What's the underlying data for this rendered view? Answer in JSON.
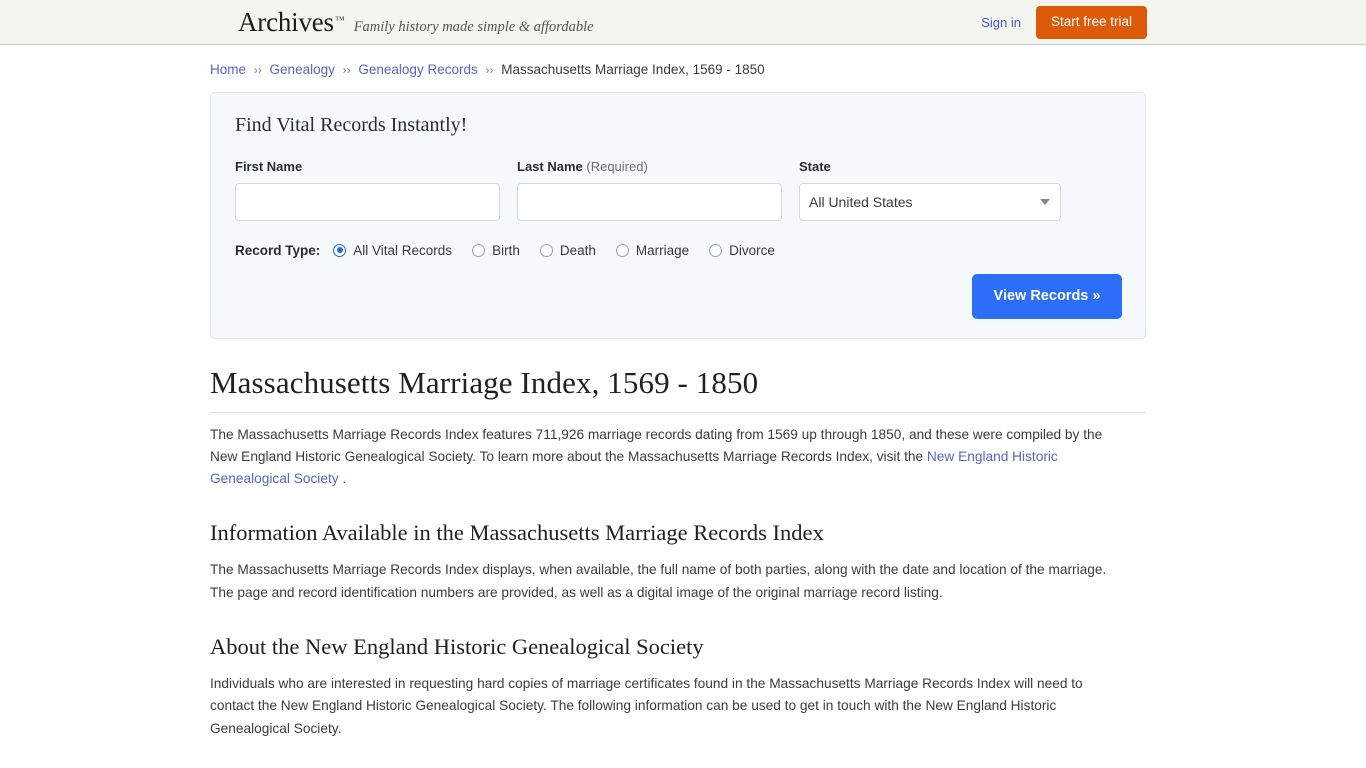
{
  "header": {
    "brand_name": "Archives",
    "brand_tm": "™",
    "tagline": "Family history made simple & affordable",
    "sign_in": "Sign in",
    "start_trial": "Start free trial",
    "trial_color": "#dd5a0b",
    "link_color": "#4257d6"
  },
  "breadcrumb": {
    "separator": "››",
    "items": [
      {
        "label": "Home",
        "is_link": true
      },
      {
        "label": "Genealogy",
        "is_link": true
      },
      {
        "label": "Genealogy Records",
        "is_link": true
      },
      {
        "label": "Massachusetts Marriage Index, 1569 - 1850",
        "is_link": false
      }
    ]
  },
  "search_form": {
    "title": "Find Vital Records Instantly!",
    "first_name": {
      "label": "First Name",
      "value": "",
      "placeholder": ""
    },
    "last_name": {
      "label": "Last Name",
      "required_note": "(Required)",
      "value": "",
      "placeholder": ""
    },
    "state": {
      "label": "State",
      "selected": "All United States"
    },
    "record_type": {
      "label": "Record Type:",
      "options": [
        {
          "label": "All Vital Records",
          "checked": true
        },
        {
          "label": "Birth",
          "checked": false
        },
        {
          "label": "Death",
          "checked": false
        },
        {
          "label": "Marriage",
          "checked": false
        },
        {
          "label": "Divorce",
          "checked": false
        }
      ]
    },
    "submit_label": "View Records »",
    "submit_color": "#2c6ef5"
  },
  "article": {
    "title": "Massachusetts Marriage Index, 1569 - 1850",
    "intro_part1": "The Massachusetts Marriage Records Index features 711,926 marriage records dating from 1569 up through 1850, and these were compiled by the New England Historic Genealogical Society. To learn more about the Massachusetts Marriage Records Index, visit the ",
    "intro_link": "New England Historic Genealogical Society",
    "intro_part2": " .",
    "section2_title": "Information Available in the Massachusetts Marriage Records Index",
    "section2_text": "The Massachusetts Marriage Records Index displays, when available, the full name of both parties, along with the date and location of the marriage. The page and record identification numbers are provided, as well as a digital image of the original marriage record listing.",
    "section3_title": "About the New England Historic Genealogical Society",
    "section3_text": "Individuals who are interested in requesting hard copies of marriage certificates found in the Massachusetts Marriage Records Index will need to contact the New England Historic Genealogical Society. The following information can be used to get in touch with the New England Historic Genealogical Society."
  }
}
